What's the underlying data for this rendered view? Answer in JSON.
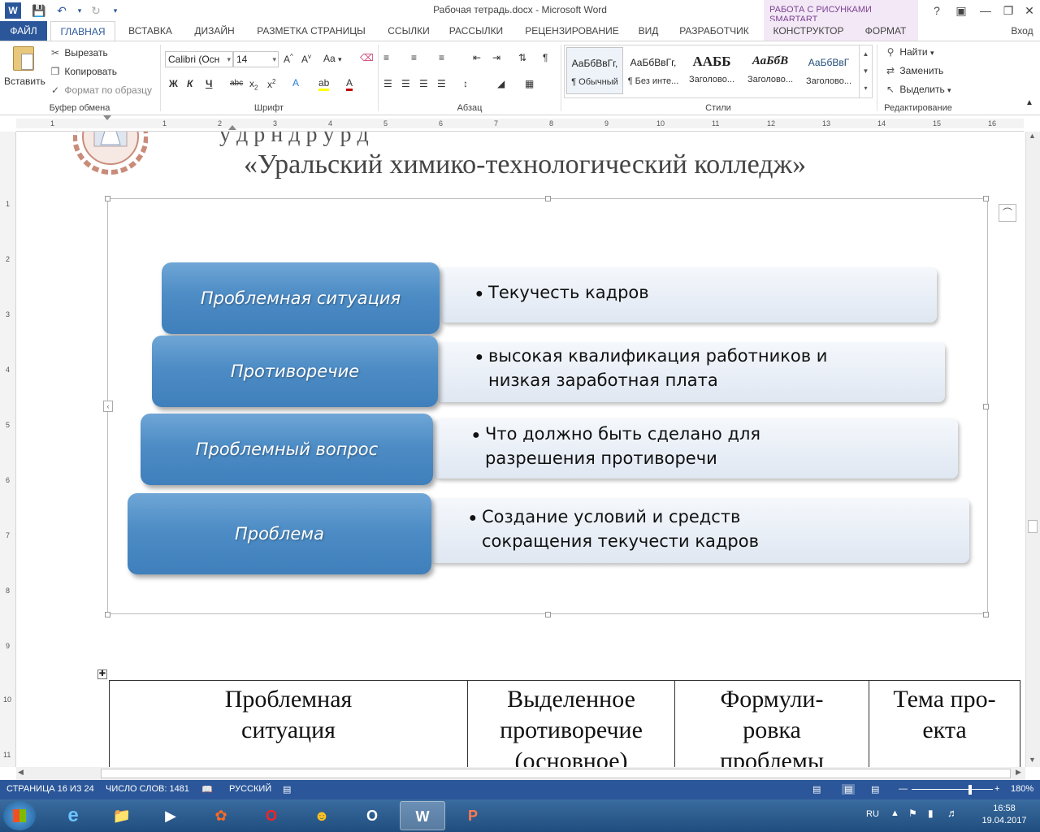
{
  "window": {
    "title": "Рабочая тетрадь.docx - Microsoft Word",
    "context_group": "РАБОТА С РИСУНКАМИ SMARTART",
    "signin": "Вход"
  },
  "tabs": [
    {
      "label": "ФАЙЛ"
    },
    {
      "label": "ГЛАВНАЯ"
    },
    {
      "label": "ВСТАВКА"
    },
    {
      "label": "ДИЗАЙН"
    },
    {
      "label": "РАЗМЕТКА СТРАНИЦЫ"
    },
    {
      "label": "ССЫЛКИ"
    },
    {
      "label": "РАССЫЛКИ"
    },
    {
      "label": "РЕЦЕНЗИРОВАНИЕ"
    },
    {
      "label": "ВИД"
    },
    {
      "label": "РАЗРАБОТЧИК"
    },
    {
      "label": "КОНСТРУКТОР"
    },
    {
      "label": "ФОРМАТ"
    }
  ],
  "ribbon": {
    "clipboard": {
      "paste": "Вставить",
      "cut": "Вырезать",
      "copy": "Копировать",
      "format_painter": "Формат по образцу",
      "label": "Буфер обмена"
    },
    "font": {
      "name": "Calibri (Осн",
      "size": "14",
      "label": "Шрифт",
      "bold": "Ж",
      "italic": "К",
      "underline": "Ч",
      "strike": "abc",
      "change_case": "Aa"
    },
    "paragraph": {
      "label": "Абзац"
    },
    "styles": {
      "label": "Стили",
      "items": [
        {
          "sample": "АаБбВвГг,",
          "name": "¶ Обычный"
        },
        {
          "sample": "АаБбВвГг,",
          "name": "¶ Без инте..."
        },
        {
          "sample": "ААББ",
          "name": "Заголово..."
        },
        {
          "sample": "АаБбВ",
          "name": "Заголово..."
        },
        {
          "sample": "АаБбВвГ",
          "name": "Заголово..."
        }
      ]
    },
    "editing": {
      "label": "Редактирование",
      "find": "Найти",
      "replace": "Заменить",
      "select": "Выделить"
    }
  },
  "ruler": {
    "h_numbers": [
      "1",
      "1",
      "2",
      "3",
      "4",
      "5",
      "6",
      "7",
      "8",
      "9",
      "10",
      "11",
      "12",
      "13",
      "14",
      "15",
      "16"
    ],
    "v_numbers": [
      "1",
      "2",
      "3",
      "4",
      "5",
      "6",
      "7",
      "8",
      "9",
      "10",
      "11"
    ]
  },
  "document": {
    "college_partial": "у д р н          д                  р          у р д",
    "college_name": "«Уральский химико-технологический колледж»",
    "smartart": [
      {
        "title": "Проблемная ситуация",
        "lines": [
          "Текучесть кадров"
        ]
      },
      {
        "title": "Противоречие",
        "lines": [
          "высокая квалификация работников и",
          "низкая заработная плата"
        ]
      },
      {
        "title": "Проблемный вопрос",
        "lines": [
          "Что должно быть сделано для",
          "разрешения противоречи"
        ]
      },
      {
        "title": "Проблема",
        "lines": [
          "Создание условий и средств",
          "сокращения текучести кадров"
        ]
      }
    ],
    "table_headers": [
      {
        "lines": [
          "Проблемная",
          "ситуация"
        ]
      },
      {
        "lines": [
          "Выделенное",
          "противоречие",
          "(основное)"
        ]
      },
      {
        "lines": [
          "Формули-",
          "ровка",
          "проблемы"
        ]
      },
      {
        "lines": [
          "Тема про-",
          "екта"
        ]
      }
    ]
  },
  "statusbar": {
    "page": "СТРАНИЦА 16 ИЗ 24",
    "words": "ЧИСЛО СЛОВ: 1481",
    "language": "РУССКИЙ",
    "zoom": "180%",
    "zoom_level": 0.72
  },
  "taskbar": {
    "lang": "RU",
    "time": "16:58",
    "date": "19.04.2017"
  }
}
